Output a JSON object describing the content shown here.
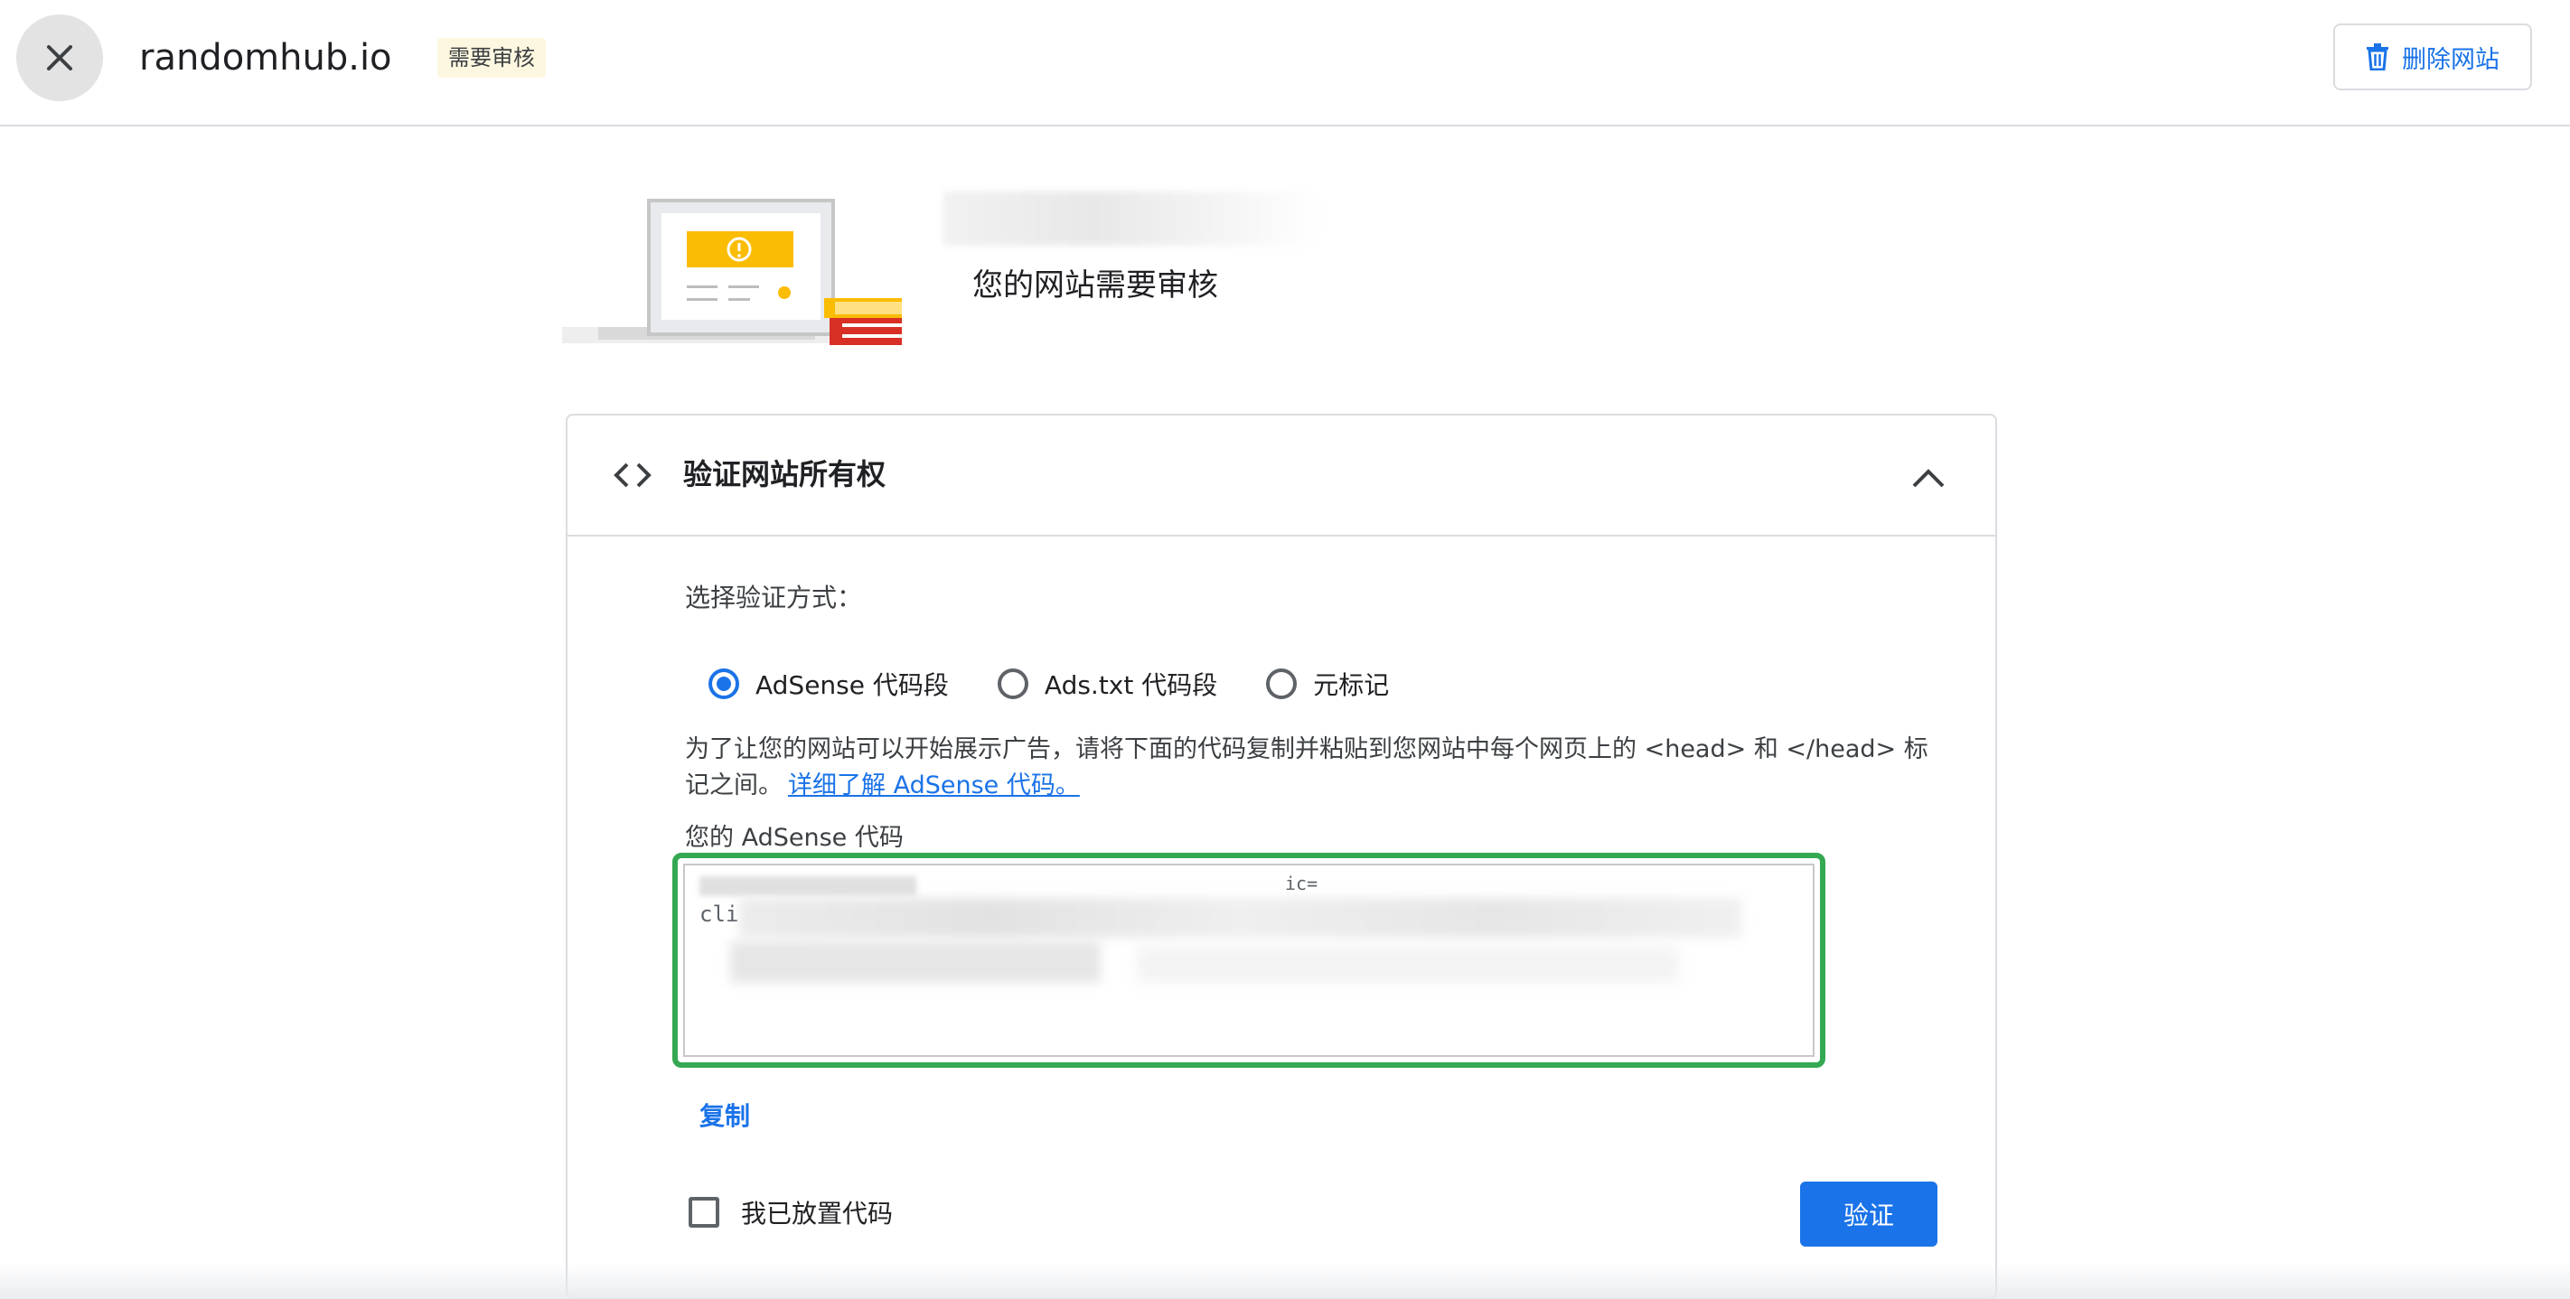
{
  "topbar": {
    "site_name": "randomhub.io",
    "status_badge": "需要审核",
    "delete_button": "删除网站"
  },
  "hero": {
    "title": "您的网站需要审核"
  },
  "card": {
    "title": "验证网站所有权",
    "method_label": "选择验证方式：",
    "methods": [
      {
        "label": "AdSense 代码段",
        "selected": true
      },
      {
        "label": "Ads.txt 代码段",
        "selected": false
      },
      {
        "label": "元标记",
        "selected": false
      }
    ],
    "instructions": "为了让您的网站可以开始展示广告，请将下面的代码复制并粘贴到您网站中每个网页上的 <head> 和 </head> 标记之间。",
    "learn_more_link": "详细了解 AdSense 代码。",
    "code_label": "您的 AdSense 代码",
    "code_visible": "cli",
    "code_visible_top": "ic=",
    "copy_button": "复制",
    "placed_checkbox_label": "我已放置代码",
    "verify_button": "验证"
  },
  "colors": {
    "primary": "#1a73e8",
    "highlight_border": "#34a853",
    "badge_bg": "#fef7e0",
    "illustration_yellow": "#fbbc04",
    "illustration_red": "#d93025"
  },
  "icons": {
    "close": "close-icon",
    "delete": "trash-icon",
    "code": "code-icon",
    "collapse": "chevron-up-icon"
  }
}
